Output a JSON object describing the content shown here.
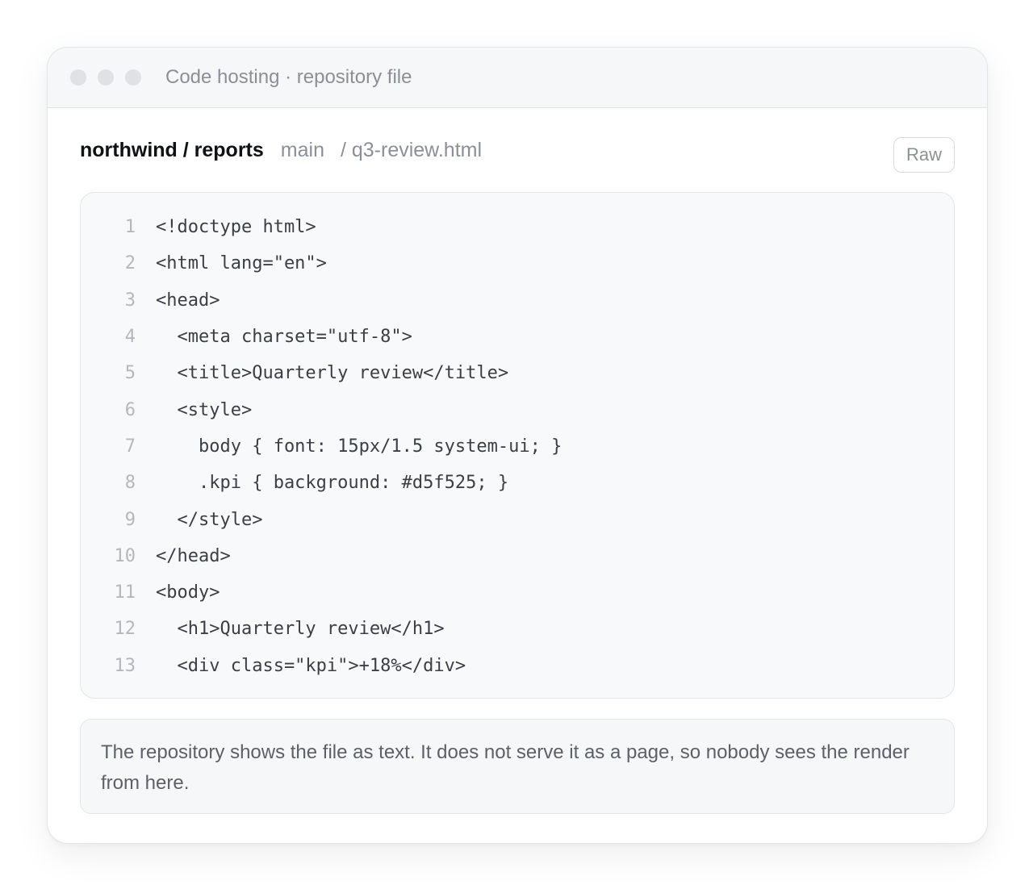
{
  "window": {
    "title": "Code hosting · repository file"
  },
  "file_header": {
    "repo": "northwind / reports",
    "branch": "main",
    "path": "/ q3-review.html",
    "raw_label": "Raw"
  },
  "code": {
    "lines": [
      {
        "number": "1",
        "text": "<!doctype html>"
      },
      {
        "number": "2",
        "text": "<html lang=\"en\">"
      },
      {
        "number": "3",
        "text": "<head>"
      },
      {
        "number": "4",
        "text": "  <meta charset=\"utf-8\">"
      },
      {
        "number": "5",
        "text": "  <title>Quarterly review</title>"
      },
      {
        "number": "6",
        "text": "  <style>"
      },
      {
        "number": "7",
        "text": "    body { font: 15px/1.5 system-ui; }"
      },
      {
        "number": "8",
        "text": "    .kpi { background: #d5f525; }"
      },
      {
        "number": "9",
        "text": "  </style>"
      },
      {
        "number": "10",
        "text": "</head>"
      },
      {
        "number": "11",
        "text": "<body>"
      },
      {
        "number": "12",
        "text": "  <h1>Quarterly review</h1>"
      },
      {
        "number": "13",
        "text": "  <div class=\"kpi\">+18%</div>"
      }
    ]
  },
  "note": {
    "text": "The repository shows the file as text. It does not serve it as a page, so nobody sees the render from here."
  }
}
